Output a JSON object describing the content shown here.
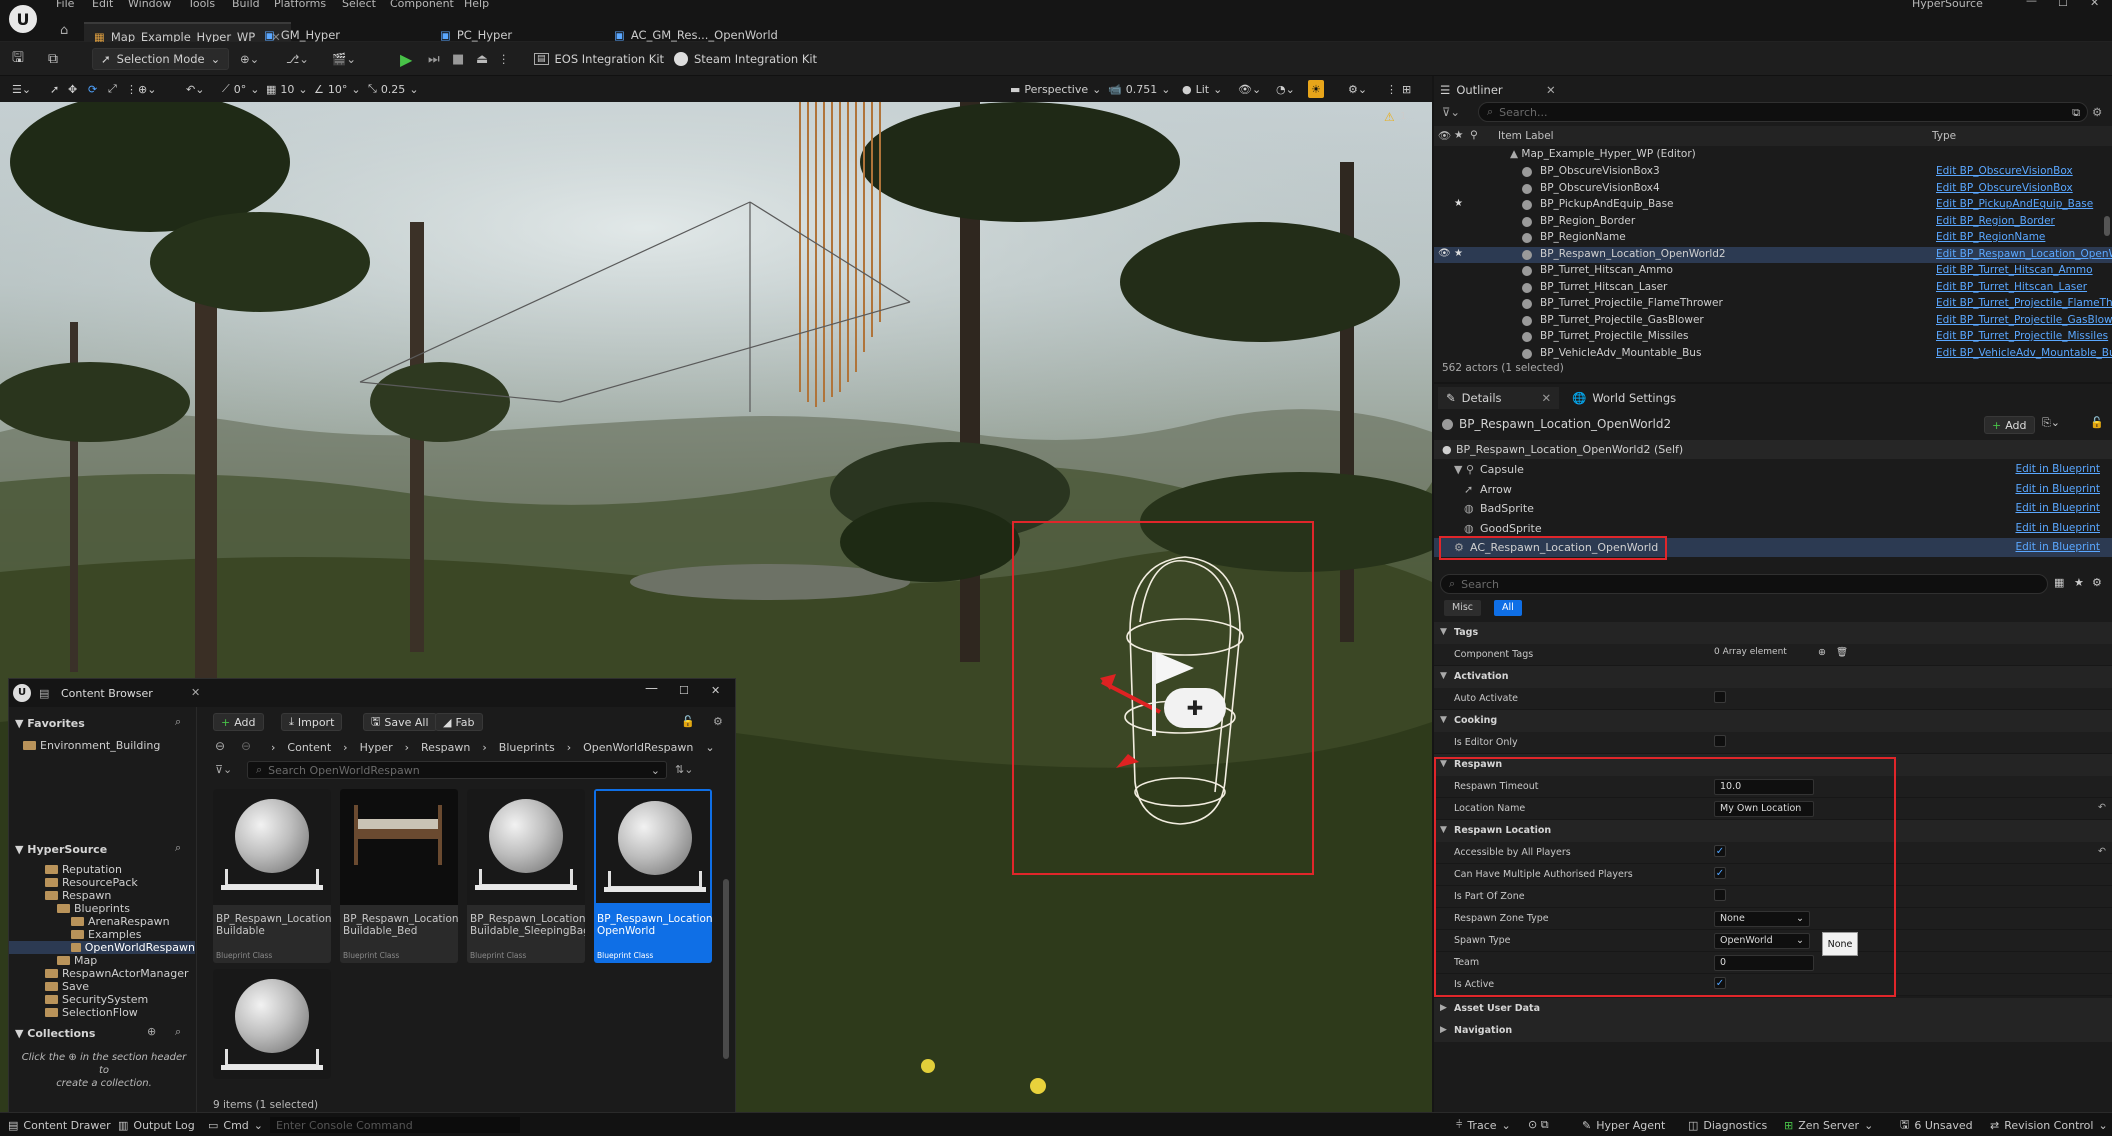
{
  "menubar": {
    "items": [
      "File",
      "Edit",
      "Window",
      "Tools",
      "Build",
      "Platforms",
      "Select",
      "Component",
      "Help"
    ],
    "title": "HyperSource"
  },
  "tabs": [
    {
      "label": "Map_Example_Hyper_WP"
    },
    {
      "label": "GM_Hyper"
    },
    {
      "label": "PC_Hyper"
    },
    {
      "label": "AC_GM_Res..._OpenWorld"
    }
  ],
  "toolbar": {
    "selection_mode": "Selection Mode",
    "eos_kit": "EOS Integration Kit",
    "steam_kit": "Steam Integration Kit"
  },
  "viewport_toolbar": {
    "angle": "0°",
    "grid": "10",
    "rot": "10°",
    "scale": "0.25",
    "perspective": "Perspective",
    "speed": "0.751",
    "lit": "Lit",
    "warn_count": "1"
  },
  "outliner": {
    "title": "Outliner",
    "search_placeholder": "Search...",
    "col_label": "Item Label",
    "col_type": "Type",
    "root": "Map_Example_Hyper_WP (Editor)",
    "rows": [
      {
        "label": "BP_ObscureVisionBox3",
        "type": "Edit BP_ObscureVisionBox",
        "star": "",
        "eye": ""
      },
      {
        "label": "BP_ObscureVisionBox4",
        "type": "Edit BP_ObscureVisionBox",
        "star": "",
        "eye": ""
      },
      {
        "label": "BP_PickupAndEquip_Base",
        "type": "Edit BP_PickupAndEquip_Base",
        "star": "★",
        "eye": ""
      },
      {
        "label": "BP_Region_Border",
        "type": "Edit BP_Region_Border",
        "star": "",
        "eye": ""
      },
      {
        "label": "BP_RegionName",
        "type": "Edit BP_RegionName",
        "star": "",
        "eye": ""
      },
      {
        "label": "BP_Respawn_Location_OpenWorld2",
        "type": "Edit BP_Respawn_Location_OpenWorld",
        "star": "★",
        "eye": "👁"
      },
      {
        "label": "BP_Turret_Hitscan_Ammo",
        "type": "Edit BP_Turret_Hitscan_Ammo",
        "star": "",
        "eye": ""
      },
      {
        "label": "BP_Turret_Hitscan_Laser",
        "type": "Edit BP_Turret_Hitscan_Laser",
        "star": "",
        "eye": ""
      },
      {
        "label": "BP_Turret_Projectile_FlameThrower",
        "type": "Edit BP_Turret_Projectile_FlameThrower",
        "star": "",
        "eye": ""
      },
      {
        "label": "BP_Turret_Projectile_GasBlower",
        "type": "Edit BP_Turret_Projectile_GasBlower",
        "star": "",
        "eye": ""
      },
      {
        "label": "BP_Turret_Projectile_Missiles",
        "type": "Edit BP_Turret_Projectile_Missiles",
        "star": "",
        "eye": ""
      },
      {
        "label": "BP_VehicleAdv_Mountable_Bus",
        "type": "Edit BP_VehicleAdv_Mountable_Bus",
        "star": "",
        "eye": ""
      }
    ],
    "actor_count": "562 actors (1 selected)"
  },
  "details": {
    "tab_details": "Details",
    "tab_world": "World Settings",
    "object_name": "BP_Respawn_Location_OpenWorld2",
    "add_label": "Add",
    "self_label": "BP_Respawn_Location_OpenWorld2 (Self)",
    "components": [
      {
        "label": "Capsule",
        "edit": "Edit in Blueprint"
      },
      {
        "label": "Arrow",
        "edit": "Edit in Blueprint"
      },
      {
        "label": "BadSprite",
        "edit": "Edit in Blueprint"
      },
      {
        "label": "GoodSprite",
        "edit": "Edit in Blueprint"
      },
      {
        "label": "AC_Respawn_Location_OpenWorld",
        "edit": "Edit in Blueprint"
      }
    ],
    "search_placeholder": "Search",
    "filter_misc": "Misc",
    "filter_all": "All",
    "sections": {
      "tags": "Tags",
      "activation": "Activation",
      "cooking": "Cooking",
      "respawn": "Respawn",
      "respawn_location": "Respawn Location",
      "asset_user_data": "Asset User Data",
      "navigation": "Navigation"
    },
    "props": {
      "component_tags": "Component Tags",
      "array_elements": "0 Array element",
      "auto_activate": "Auto Activate",
      "is_editor_only": "Is Editor Only",
      "respawn_timeout": "Respawn Timeout",
      "respawn_timeout_val": "10.0",
      "location_name": "Location Name",
      "location_name_val": "My Own Location",
      "accessible": "Accessible by All Players",
      "multi_auth": "Can Have Multiple Authorised Players",
      "part_of_zone": "Is Part Of Zone",
      "zone_type": "Respawn Zone Type",
      "zone_type_val": "None",
      "spawn_type": "Spawn Type",
      "spawn_type_val": "OpenWorld",
      "team": "Team",
      "team_val": "0",
      "is_active": "Is Active",
      "tooltip": "None"
    }
  },
  "content_browser": {
    "title": "Content Browser",
    "add": "Add",
    "import": "Import",
    "save_all": "Save All",
    "fab": "Fab",
    "path": [
      "Content",
      "Hyper",
      "Respawn",
      "Blueprints",
      "OpenWorldRespawn"
    ],
    "search_placeholder": "Search OpenWorldRespawn",
    "favorites": "Favorites",
    "fav_item": "Environment_Building",
    "project": "HyperSource",
    "tree": [
      "Reputation",
      "ResourcePack",
      "Respawn",
      "Blueprints",
      "ArenaRespawn",
      "Examples",
      "OpenWorldRespawn",
      "Map",
      "RespawnActorManager",
      "Save",
      "SecuritySystem",
      "SelectionFlow"
    ],
    "collections": "Collections",
    "collections_hint_a": "Click the",
    "collections_hint_b": "in the section header to",
    "collections_hint_c": "create a collection.",
    "assets": [
      {
        "name": "BP_Respawn_Location_ Buildable",
        "cls": "Blueprint Class"
      },
      {
        "name": "BP_Respawn_Location_ Buildable_Bed",
        "cls": "Blueprint Class"
      },
      {
        "name": "BP_Respawn_Location_ Buildable_SleepingBag",
        "cls": "Blueprint Class"
      },
      {
        "name": "BP_Respawn_Location_ OpenWorld",
        "cls": "Blueprint Class"
      },
      {
        "name": "",
        "cls": ""
      }
    ],
    "item_count": "9 items (1 selected)"
  },
  "statusbar": {
    "content_drawer": "Content Drawer",
    "output_log": "Output Log",
    "cmd": "Cmd",
    "console_placeholder": "Enter Console Command",
    "trace": "Trace",
    "hyper_agent": "Hyper Agent",
    "diagnostics": "Diagnostics",
    "zen": "Zen Server",
    "unsaved": "6 Unsaved",
    "revision": "Revision Control"
  },
  "colors": {
    "accent": "#0f6fe6",
    "highlight": "#e0262a",
    "link": "#5aa7ff",
    "play": "#48c248"
  }
}
